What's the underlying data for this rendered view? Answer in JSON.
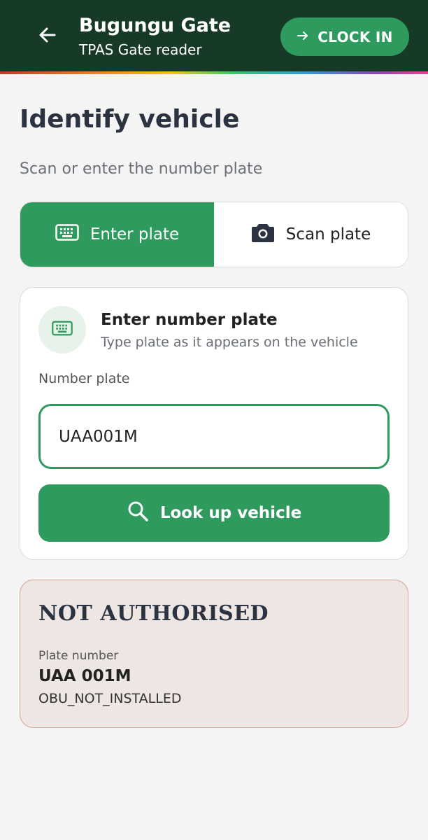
{
  "header": {
    "title": "Bugungu Gate",
    "subtitle": "TPAS Gate reader",
    "clock_in_label": "CLOCK IN",
    "back_icon": "arrow-left-icon",
    "clock_icon": "arrow-right-icon"
  },
  "page": {
    "title": "Identify vehicle",
    "subtitle": "Scan or enter the number plate"
  },
  "mode_tabs": [
    {
      "label": "Enter plate",
      "icon": "keyboard-icon",
      "active": true
    },
    {
      "label": "Scan plate",
      "icon": "camera-icon",
      "active": false
    }
  ],
  "entry_card": {
    "title": "Enter number plate",
    "subtitle": "Type plate as it appears on the vehicle",
    "icon": "keyboard-icon",
    "field_label": "Number plate",
    "field_value": "UAA001M",
    "lookup_label": "Look up vehicle",
    "lookup_icon": "search-icon"
  },
  "result": {
    "status": "NOT AUTHORISED",
    "plate_label": "Plate number",
    "plate_value": "UAA 001M",
    "reason": "OBU_NOT_INSTALLED"
  },
  "colors": {
    "header_bg": "#173a27",
    "accent": "#2e9a5e",
    "result_bg": "#ede6e2",
    "result_border": "#d9a390"
  }
}
